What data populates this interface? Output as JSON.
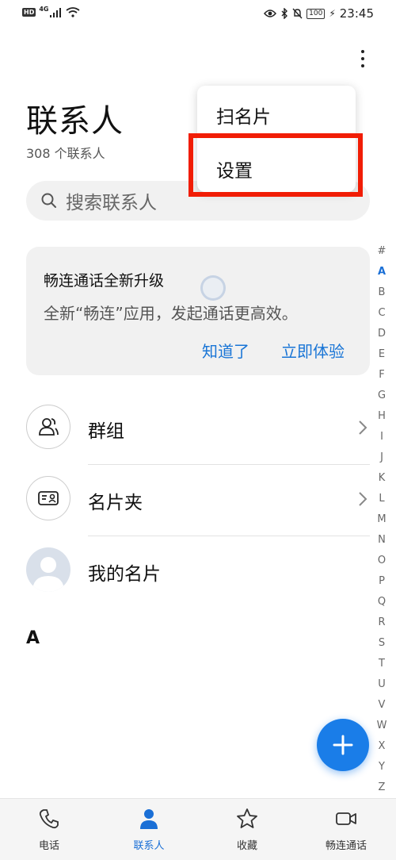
{
  "status_bar": {
    "network_badge": "HD",
    "net_type": "4G",
    "battery": "100",
    "time": "23:45"
  },
  "header": {
    "title": "联系人",
    "count": "308 个联系人"
  },
  "search": {
    "placeholder": "搜索联系人"
  },
  "menu": {
    "items": [
      "扫名片",
      "设置"
    ],
    "highlighted": "设置",
    "highlight_color": "#f11d05"
  },
  "promo": {
    "title": "畅连通话全新升级",
    "description": "全新“畅连”应用，发起通话更高效。",
    "dismiss_label": "知道了",
    "try_label": "立即体验"
  },
  "list": {
    "items": [
      {
        "label": "群组",
        "icon": "group-icon"
      },
      {
        "label": "名片夹",
        "icon": "card-holder-icon"
      },
      {
        "label": "我的名片",
        "icon": "profile-avatar"
      }
    ],
    "section_letter": "A"
  },
  "alpha_index": {
    "letters": [
      "#",
      "A",
      "B",
      "C",
      "D",
      "E",
      "F",
      "G",
      "H",
      "I",
      "J",
      "K",
      "L",
      "M",
      "N",
      "O",
      "P",
      "Q",
      "R",
      "S",
      "T",
      "U",
      "V",
      "W",
      "X",
      "Y",
      "Z"
    ],
    "active": "A"
  },
  "bottom_nav": {
    "items": [
      {
        "label": "电话",
        "icon": "phone-icon"
      },
      {
        "label": "联系人",
        "icon": "contacts-icon"
      },
      {
        "label": "收藏",
        "icon": "star-icon"
      },
      {
        "label": "畅连通话",
        "icon": "video-call-icon"
      }
    ],
    "active": "联系人"
  },
  "colors": {
    "accent": "#1a7de8",
    "link": "#1975d6"
  }
}
